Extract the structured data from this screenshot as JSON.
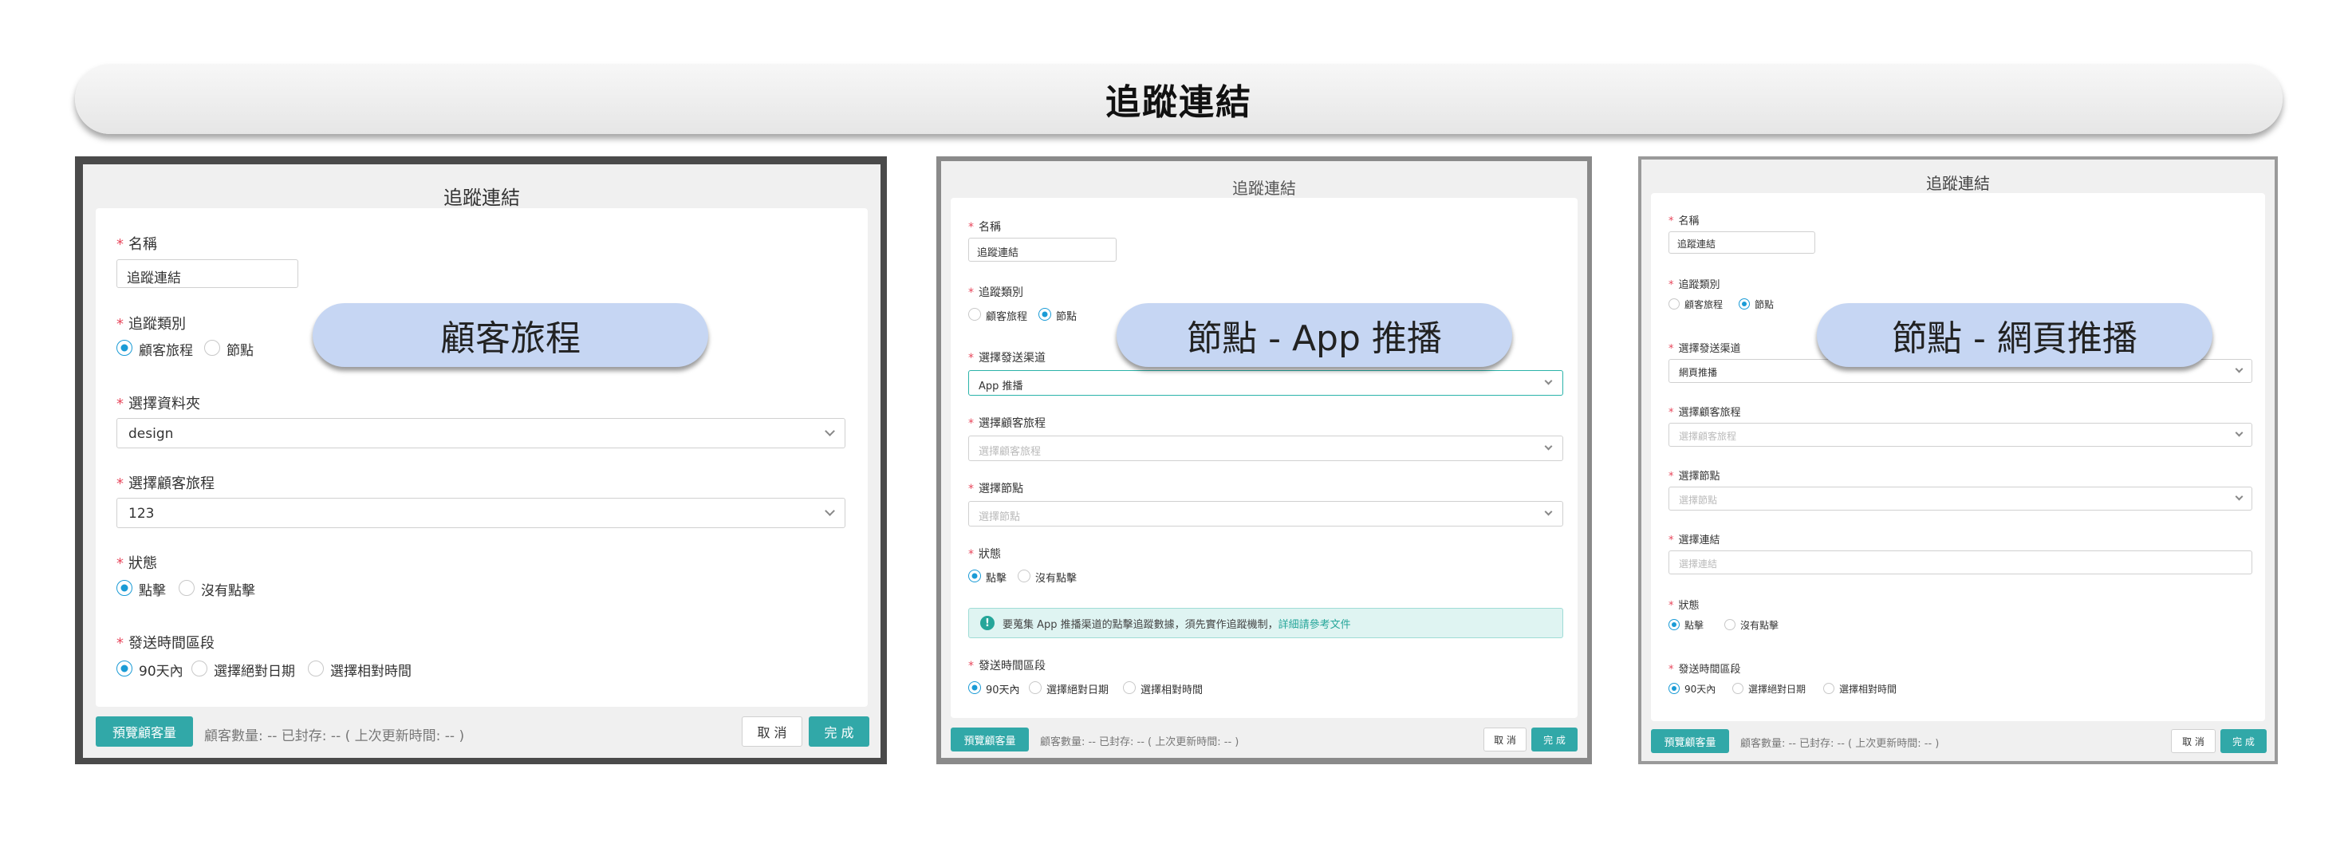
{
  "banner": {
    "title": "追蹤連結"
  },
  "common": {
    "modal_title": "追蹤連結",
    "name_label": "名稱",
    "name_value": "追蹤連結",
    "type_label": "追蹤類別",
    "type_journey": "顧客旅程",
    "type_node": "節點",
    "status_label": "狀態",
    "status_click": "點擊",
    "status_no_click": "沒有點擊",
    "time_label": "發送時間區段",
    "time_90": "90天內",
    "time_absolute": "選擇絕對日期",
    "time_relative": "選擇相對時間",
    "preview_button": "預覽顧客量",
    "footer_stats": "顧客數量: -- 已封存: -- ( 上次更新時間: -- )",
    "cancel_button": "取 消",
    "done_button": "完 成"
  },
  "panel1": {
    "tag": "顧客旅程",
    "folder_label": "選擇資料夾",
    "folder_value": "design",
    "journey_label": "選擇顧客旅程",
    "journey_value": "123"
  },
  "panel2": {
    "tag": "節點 - App 推播",
    "channel_label": "選擇發送渠道",
    "channel_value": "App 推播",
    "journey_label": "選擇顧客旅程",
    "journey_placeholder": "選擇顧客旅程",
    "node_label": "選擇節點",
    "node_placeholder": "選擇節點",
    "notice_text": "要蒐集 App 推播渠道的點擊追蹤數據，須先實作追蹤機制，",
    "notice_link": "詳細請參考文件"
  },
  "panel3": {
    "tag": "節點 - 網頁推播",
    "channel_label": "選擇發送渠道",
    "channel_value": "網頁推播",
    "journey_label": "選擇顧客旅程",
    "journey_placeholder": "選擇顧客旅程",
    "node_label": "選擇節點",
    "node_placeholder": "選擇節點",
    "link_label": "選擇連結",
    "link_placeholder": "選擇連結"
  },
  "colors": {
    "accent": "#31a8a8",
    "radio": "#1a9bd6",
    "required": "#e8465b",
    "pill": "#c6d6f3"
  }
}
